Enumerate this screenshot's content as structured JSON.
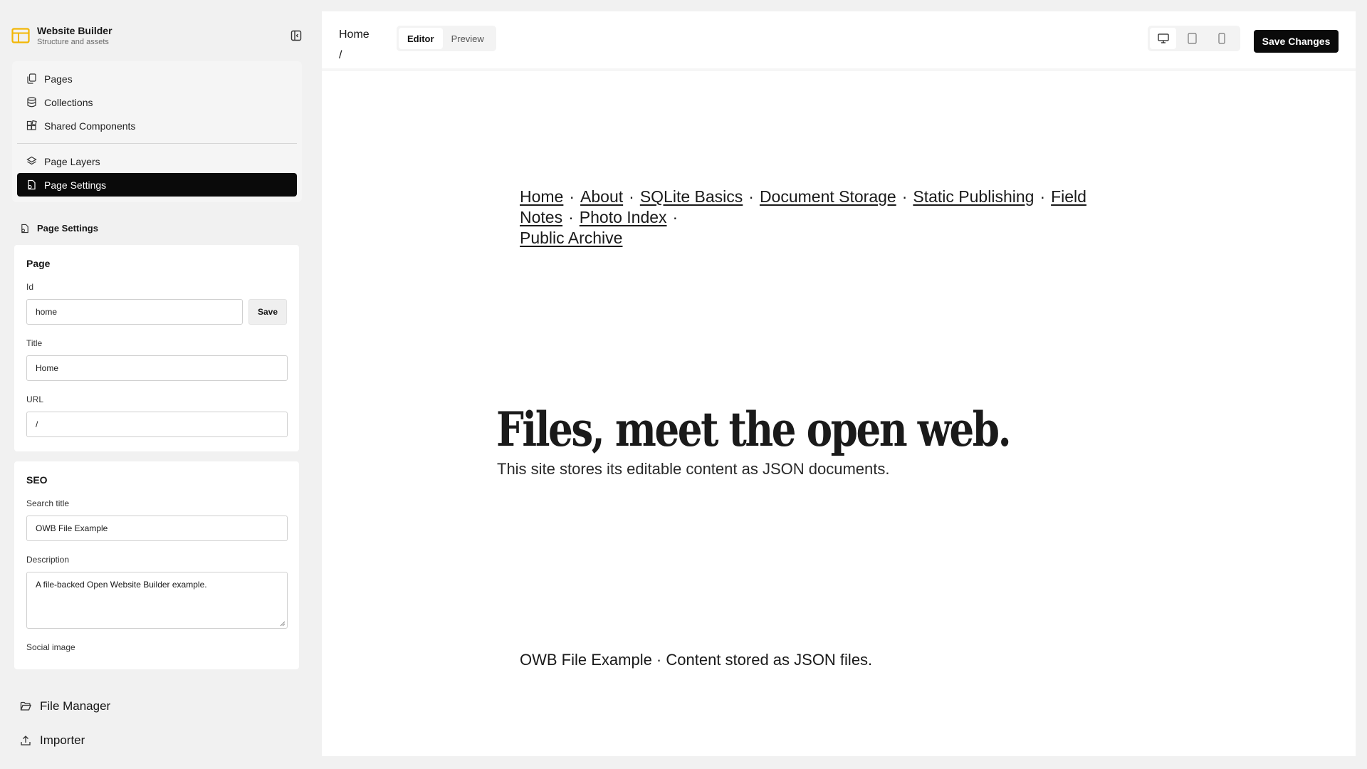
{
  "brand": {
    "title": "Website Builder",
    "subtitle": "Structure and assets"
  },
  "nav": {
    "pages": "Pages",
    "collections": "Collections",
    "shared_components": "Shared Components",
    "page_layers": "Page Layers",
    "page_settings": "Page Settings"
  },
  "settings": {
    "heading": "Page Settings",
    "page": {
      "title": "Page",
      "id_label": "Id",
      "id_value": "home",
      "save_label": "Save",
      "title_label": "Title",
      "title_value": "Home",
      "url_label": "URL",
      "url_value": "/"
    },
    "seo": {
      "title": "SEO",
      "search_title_label": "Search title",
      "search_title_value": "OWB File Example",
      "description_label": "Description",
      "description_value": "A file-backed Open Website Builder example.",
      "social_image_label": "Social image"
    }
  },
  "bottom": {
    "file_manager": "File Manager",
    "importer": "Importer"
  },
  "topbar": {
    "crumb_title": "Home",
    "crumb_path": "/",
    "tab_editor": "Editor",
    "tab_preview": "Preview",
    "active_tab": "Editor",
    "active_device": "desktop",
    "save_changes": "Save Changes"
  },
  "preview": {
    "nav_links": [
      "Home",
      "About",
      "SQLite Basics",
      "Document Storage",
      "Static Publishing",
      "Field Notes",
      "Photo Index",
      "Public Archive"
    ],
    "nav_separator": "·",
    "hero_title": "Files, meet the open web.",
    "hero_subtitle": "This site stores its editable content as JSON documents.",
    "footer": "OWB File Example · Content stored as JSON files."
  },
  "colors": {
    "accent": "#f2b705",
    "active_bg": "#0a0a0a",
    "app_bg": "#f1f1f1"
  }
}
